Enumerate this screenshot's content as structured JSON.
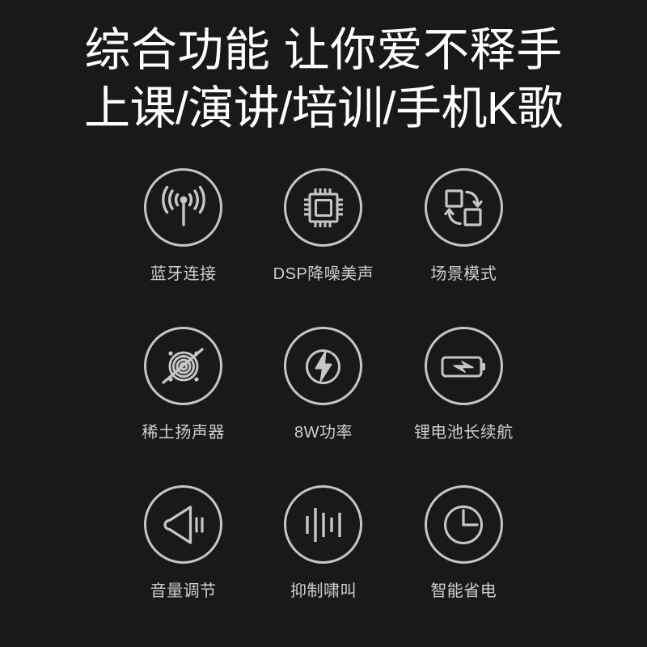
{
  "page": {
    "background_color": "#191919",
    "text_color": "#ffffff",
    "icon_color": "#c6c6c6",
    "label_color": "#cfcfcf"
  },
  "headings": {
    "line1": "综合功能 让你爱不释手",
    "line2": "上课/演讲/培训/手机K歌"
  },
  "features": [
    {
      "icon": "wifi-antenna-icon",
      "label": "蓝牙连接"
    },
    {
      "icon": "chip-icon",
      "label": "DSP降噪美声"
    },
    {
      "icon": "swap-squares-icon",
      "label": "场景模式"
    },
    {
      "icon": "speaker-driver-icon",
      "label": "稀土扬声器"
    },
    {
      "icon": "lightning-circle-icon",
      "label": "8W功率"
    },
    {
      "icon": "battery-bolt-icon",
      "label": "锂电池长续航"
    },
    {
      "icon": "volume-icon",
      "label": "音量调节"
    },
    {
      "icon": "waveform-icon",
      "label": "抑制啸叫"
    },
    {
      "icon": "clock-icon",
      "label": "智能省电"
    }
  ]
}
